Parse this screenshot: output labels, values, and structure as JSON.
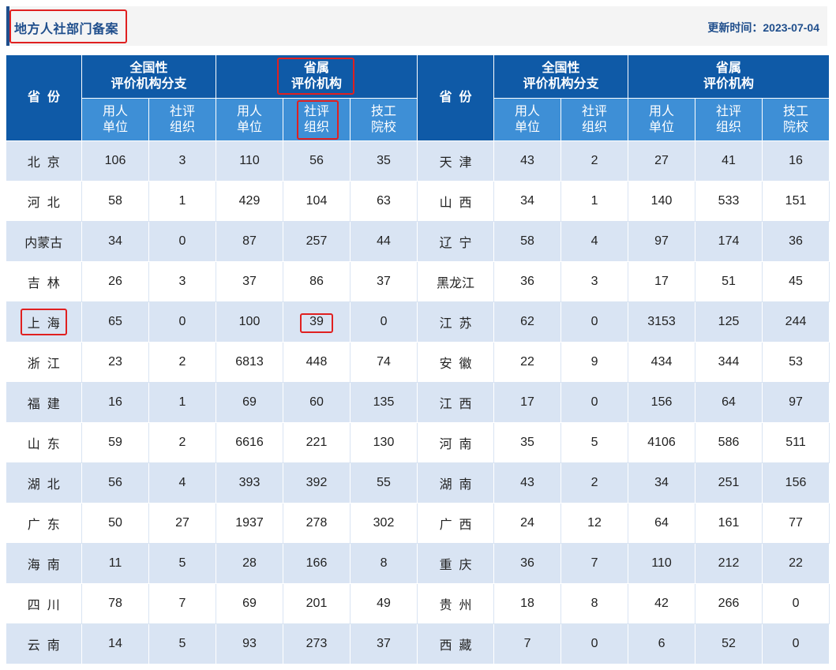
{
  "header": {
    "title": "地方人社部门备案",
    "update_label": "更新时间：2023-07-04"
  },
  "table": {
    "col_province": "省  份",
    "group_national": "全国性\n评价机构分支",
    "group_provincial": "省属\n评价机构",
    "sub_employer": "用人\n单位",
    "sub_social": "社评\n组织",
    "sub_school": "技工\n院校",
    "rows": [
      [
        "北  京",
        "106",
        "3",
        "110",
        "56",
        "35",
        "天  津",
        "43",
        "2",
        "27",
        "41",
        "16"
      ],
      [
        "河  北",
        "58",
        "1",
        "429",
        "104",
        "63",
        "山  西",
        "34",
        "1",
        "140",
        "533",
        "151"
      ],
      [
        "内蒙古",
        "34",
        "0",
        "87",
        "257",
        "44",
        "辽  宁",
        "58",
        "4",
        "97",
        "174",
        "36"
      ],
      [
        "吉  林",
        "26",
        "3",
        "37",
        "86",
        "37",
        "黑龙江",
        "36",
        "3",
        "17",
        "51",
        "45"
      ],
      [
        "上  海",
        "65",
        "0",
        "100",
        "39",
        "0",
        "江  苏",
        "62",
        "0",
        "3153",
        "125",
        "244"
      ],
      [
        "浙  江",
        "23",
        "2",
        "6813",
        "448",
        "74",
        "安  徽",
        "22",
        "9",
        "434",
        "344",
        "53"
      ],
      [
        "福  建",
        "16",
        "1",
        "69",
        "60",
        "135",
        "江  西",
        "17",
        "0",
        "156",
        "64",
        "97"
      ],
      [
        "山  东",
        "59",
        "2",
        "6616",
        "221",
        "130",
        "河  南",
        "35",
        "5",
        "4106",
        "586",
        "511"
      ],
      [
        "湖  北",
        "56",
        "4",
        "393",
        "392",
        "55",
        "湖  南",
        "43",
        "2",
        "34",
        "251",
        "156"
      ],
      [
        "广  东",
        "50",
        "27",
        "1937",
        "278",
        "302",
        "广  西",
        "24",
        "12",
        "64",
        "161",
        "77"
      ],
      [
        "海  南",
        "11",
        "5",
        "28",
        "166",
        "8",
        "重  庆",
        "36",
        "7",
        "110",
        "212",
        "22"
      ],
      [
        "四  川",
        "78",
        "7",
        "69",
        "201",
        "49",
        "贵  州",
        "18",
        "8",
        "42",
        "266",
        "0"
      ],
      [
        "云  南",
        "14",
        "5",
        "93",
        "273",
        "37",
        "西  藏",
        "7",
        "0",
        "6",
        "52",
        "0"
      ]
    ]
  }
}
